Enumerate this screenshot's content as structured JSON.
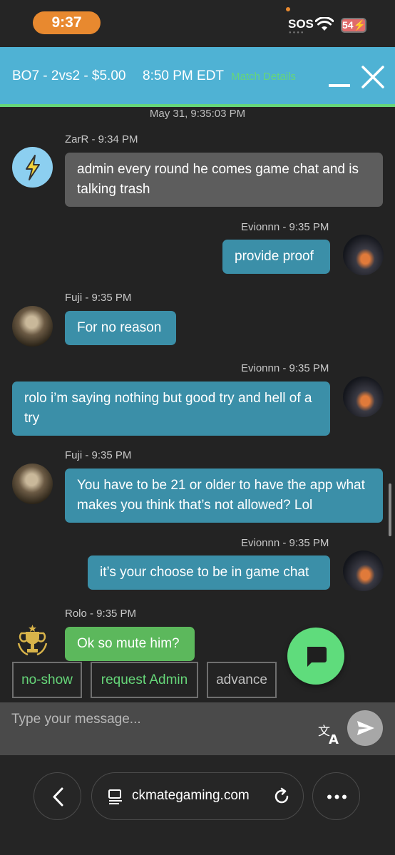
{
  "status_bar": {
    "time": "9:37",
    "sos": "SOS",
    "battery": "54"
  },
  "header": {
    "match_title": "BO7 - 2vs2 - $5.00",
    "match_time": "8:50 PM EDT",
    "match_details_link": "Match Details"
  },
  "chat": {
    "date_stamp": "May 31, 9:35:03 PM",
    "messages": [
      {
        "author_line": "ZarR - 9:34 PM",
        "text": "admin every round he comes game chat and is talking trash"
      },
      {
        "author_line": "Evionnn - 9:35 PM",
        "text": "provide proof"
      },
      {
        "author_line": "Fuji - 9:35 PM",
        "text": "For no reason"
      },
      {
        "author_line": "Evionnn - 9:35 PM",
        "text": "rolo i’m saying nothing but good try and hell of a try"
      },
      {
        "author_line": "Fuji - 9:35 PM",
        "text": "You have to be 21 or older to have the app what makes you think that’s not allowed? Lol"
      },
      {
        "author_line": "Evionnn - 9:35 PM",
        "text": "it’s your choose to be in game chat"
      },
      {
        "author_line": "Rolo - 9:35 PM",
        "text": "Ok so mute him?"
      }
    ]
  },
  "actions": {
    "no_show": "no-show",
    "request_admin": "request Admin",
    "advance": "advance"
  },
  "composer": {
    "placeholder": "Type your message..."
  },
  "browser": {
    "url": "ckmategaming.com"
  },
  "colors": {
    "header_bg": "#4fb2d4",
    "accent_green": "#66d679",
    "bubble_teal": "#3b8fa8",
    "bubble_gray": "#5d5d5d",
    "bubble_green": "#5cb85c",
    "time_pill": "#e8892f"
  }
}
